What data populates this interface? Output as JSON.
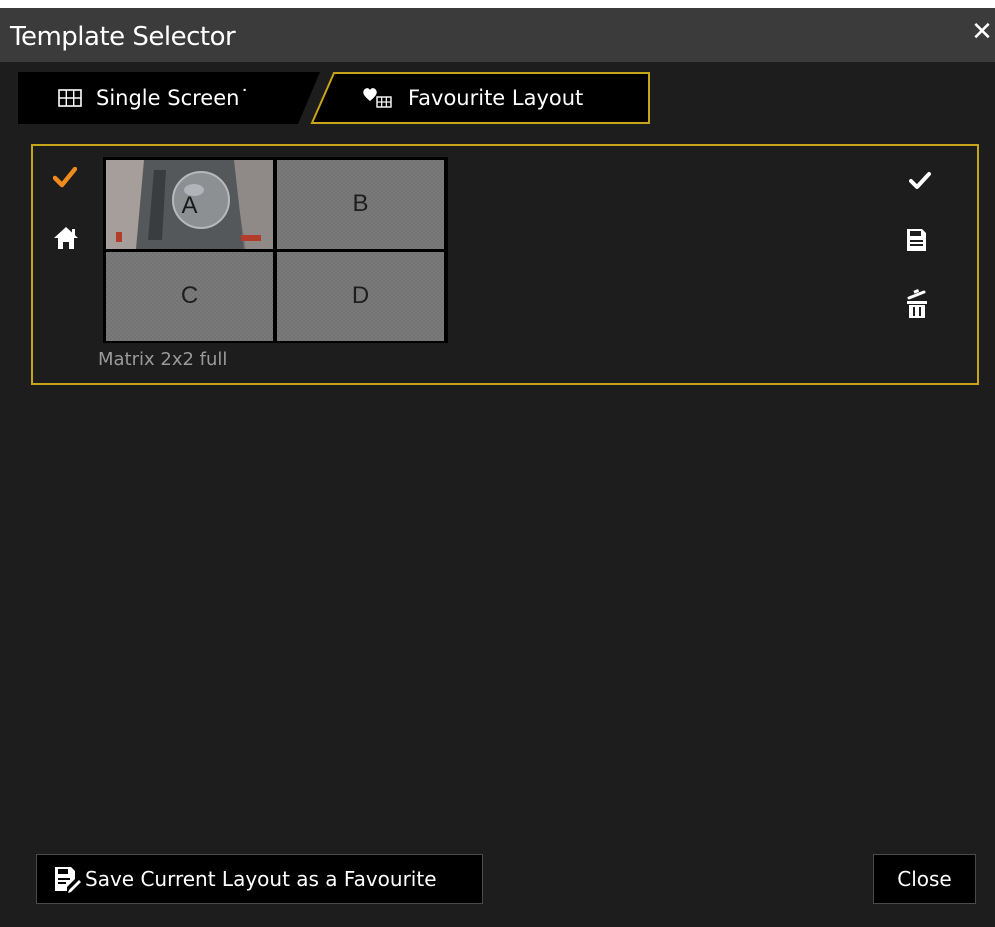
{
  "window": {
    "title": "Template Selector",
    "close_glyph": "✕"
  },
  "tabs": [
    {
      "label": "Single Screen˙",
      "icon": "grid-icon",
      "active": false
    },
    {
      "label": "Favourite Layout",
      "icon": "heart-grid-icon",
      "active": true
    }
  ],
  "favourite": {
    "cells": [
      "A",
      "B",
      "C",
      "D"
    ],
    "name": "Matrix 2x2 full",
    "default": true,
    "home": true
  },
  "actions": [
    "apply-check-icon",
    "save-disk-icon",
    "delete-trash-icon"
  ],
  "footer": {
    "save_label": "Save Current Layout as a Favourite",
    "close_label": "Close"
  },
  "colors": {
    "accent_border": "#c8a418",
    "check_orange": "#f08a1c",
    "background": "#1d1d1d",
    "titlebar": "#3b3b3b"
  }
}
